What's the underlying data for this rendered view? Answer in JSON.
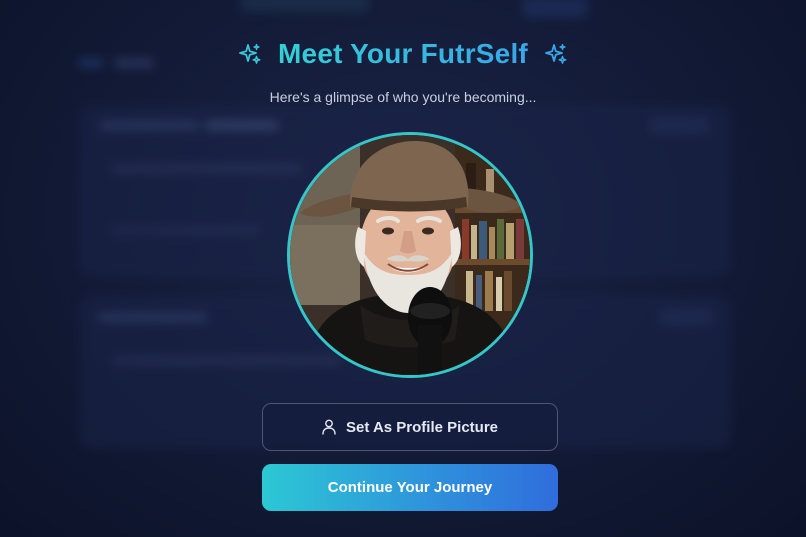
{
  "modal": {
    "title": "Meet Your FutrSelf",
    "subtitle": "Here's a glimpse of who you're becoming...",
    "portrait_alt": "Elderly man with white beard wearing a brown hat, speaking into a microphone in front of a bookshelf"
  },
  "actions": {
    "set_profile_label": "Set As Profile Picture",
    "continue_label": "Continue Your Journey"
  },
  "icons": {
    "title_left": "sparkles-icon",
    "title_right": "sparkles-icon",
    "profile_button": "user-icon"
  },
  "colors": {
    "accent_teal": "#34d0d6",
    "accent_blue": "#2f6ddc",
    "background": "#121a36"
  }
}
